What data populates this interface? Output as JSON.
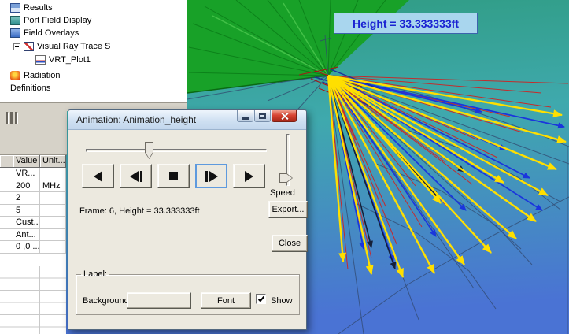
{
  "viewport": {
    "height_label": "Height = 33.333333ft"
  },
  "tree": {
    "items": [
      {
        "label": "Results",
        "icon": "results-icon"
      },
      {
        "label": "Port Field Display",
        "icon": "port-field-display-icon"
      },
      {
        "label": "Field Overlays",
        "icon": "field-overlays-icon"
      },
      {
        "label": "Visual Ray Trace S",
        "icon": "visual-ray-trace-icon"
      },
      {
        "label": "VRT_Plot1",
        "icon": "plot-icon"
      },
      {
        "label": "Radiation",
        "icon": "radiation-icon"
      },
      {
        "label": "Definitions",
        "icon": ""
      }
    ]
  },
  "properties_table": {
    "headers": [
      "Value",
      "Unit..."
    ],
    "rows": [
      {
        "value": "VR...",
        "unit": ""
      },
      {
        "value": "200",
        "unit": "MHz"
      },
      {
        "value": "2",
        "unit": ""
      },
      {
        "value": "5",
        "unit": ""
      },
      {
        "value": "Cust...",
        "unit": ""
      },
      {
        "value": "Ant...",
        "unit": ""
      },
      {
        "value": "0 ,0 ...",
        "unit": ""
      }
    ]
  },
  "dialog": {
    "title": "Animation: Animation_height",
    "frame_text": "Frame: 6, Height = 33.333333ft",
    "speed_label": "Speed",
    "buttons": {
      "export": "Export...",
      "close": "Close",
      "font": "Font"
    },
    "playback": [
      "play-reverse",
      "step-back",
      "stop",
      "step-forward",
      "play-forward"
    ],
    "slider": {
      "value_fraction": 0.35
    },
    "label_group": {
      "legend": "Label:",
      "background": "Background:",
      "show": "Show",
      "show_checked": true
    }
  },
  "colors": {
    "ray_yellow": "#ffdf00",
    "ray_red": "#d21f1f",
    "ray_blue": "#1a35dd",
    "height_label_bg": "#a9d6ee",
    "height_label_text": "#1b23d2"
  }
}
